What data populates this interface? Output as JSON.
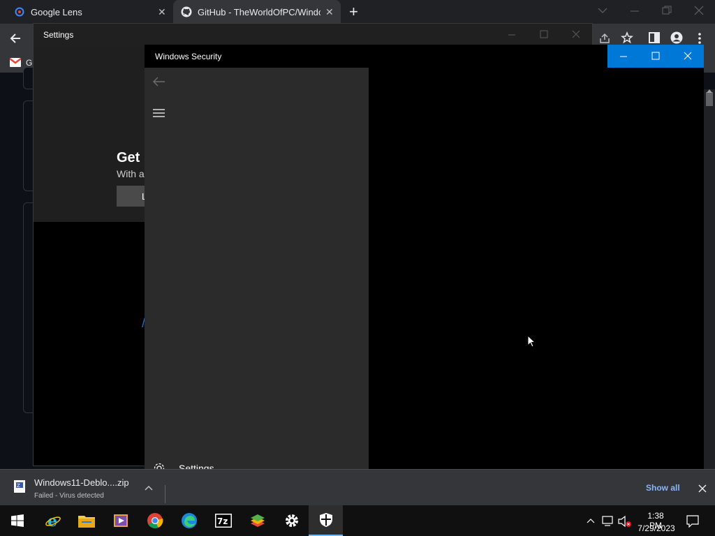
{
  "chrome": {
    "tabs": [
      {
        "title": "Google Lens",
        "close": "✕"
      },
      {
        "title": "GitHub - TheWorldOfPC/Window",
        "close": "✕"
      }
    ],
    "new_tab": "+",
    "bookmark_gmail": "Gi"
  },
  "github_page": {
    "heading_partial": "Get",
    "subtext_partial": "With a",
    "button_partial": "L"
  },
  "settings_window": {
    "title": "Settings"
  },
  "security_window": {
    "title": "Windows Security",
    "nav_settings_label": "Settings",
    "accent_color": "#0078d7"
  },
  "download": {
    "filename": "Windows11-Deblo....zip",
    "status": "Failed - Virus detected",
    "show_all": "Show all"
  },
  "taskbar": {
    "time": "1:38 PM",
    "date": "7/29/2023",
    "apps": [
      "internet-explorer",
      "file-explorer",
      "media-player",
      "chrome",
      "edge",
      "7zip",
      "bluestacks",
      "settings",
      "windows-security"
    ]
  }
}
